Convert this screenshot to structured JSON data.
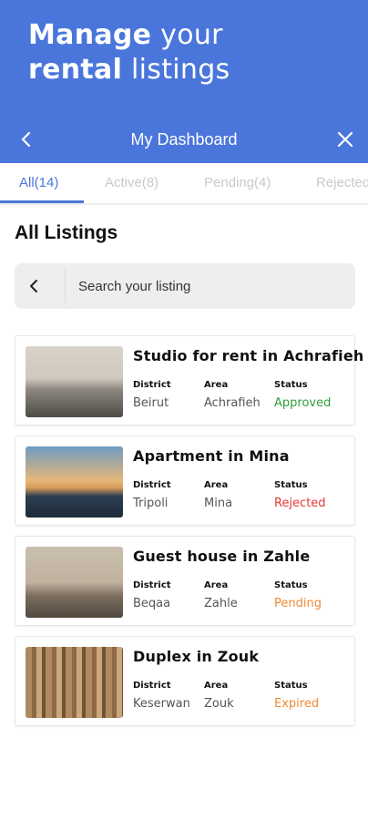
{
  "hero": {
    "line1_bold": "Manage",
    "line1_light": " your",
    "line2_bold": "rental",
    "line2_light": " listings"
  },
  "appbar": {
    "title": "My Dashboard",
    "back_icon": "chevron-left-icon",
    "close_icon": "close-icon"
  },
  "tabs": [
    {
      "label": "All(14)"
    },
    {
      "label": "Active(8)"
    },
    {
      "label": "Pending(4)"
    },
    {
      "label": "Rejected"
    }
  ],
  "section_title": "All Listings",
  "search": {
    "placeholder": "Search your listing",
    "value": ""
  },
  "headers": {
    "district": "District",
    "area": "Area",
    "status": "Status"
  },
  "listings": [
    {
      "title": "Studio for rent in Achrafieh",
      "district": "Beirut",
      "area": "Achrafieh",
      "status": "Approved",
      "status_color": "#2e9e3a"
    },
    {
      "title": "Apartment in Mina",
      "district": "Tripoli",
      "area": "Mina",
      "status": "Rejected",
      "status_color": "#e53935"
    },
    {
      "title": "Guest house in Zahle",
      "district": "Beqaa",
      "area": "Zahle",
      "status": "Pending",
      "status_color": "#ef8a33"
    },
    {
      "title": "Duplex in Zouk",
      "district": "Keserwan",
      "area": "Zouk",
      "status": "Expired",
      "status_color": "#ef8a33"
    }
  ],
  "colors": {
    "brand": "#4a76db"
  }
}
